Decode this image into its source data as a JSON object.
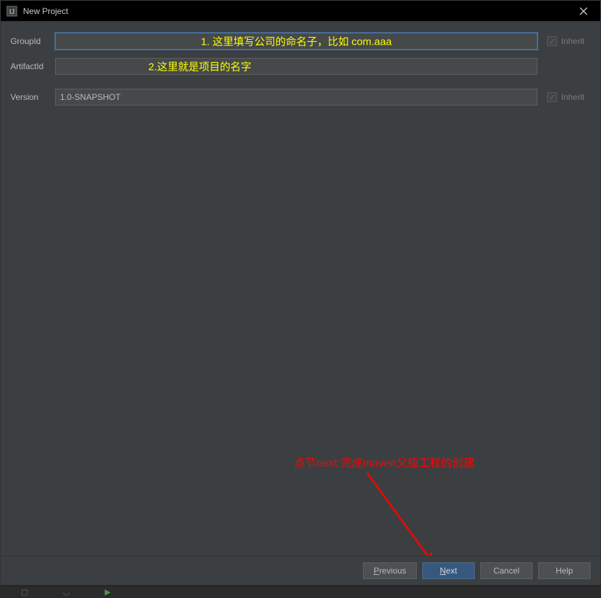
{
  "window": {
    "title": "New Project"
  },
  "form": {
    "groupId": {
      "label": "GroupId",
      "value": "",
      "annotation": "1. 这里填写公司的命名子，比如 com.aaa",
      "inheritLabel": "Inherit",
      "inheritChecked": true
    },
    "artifactId": {
      "label": "ArtifactId",
      "value": "",
      "annotation": "2.这里就是项目的名字"
    },
    "version": {
      "label": "Version",
      "value": "1.0-SNAPSHOT",
      "inheritLabel": "Inherit",
      "inheritChecked": true
    }
  },
  "annotations": {
    "nextHint": "点节next 完成maven父级工程的创建"
  },
  "buttons": {
    "previous": "Previous",
    "previousKey": "P",
    "next": "Next",
    "nextKey": "N",
    "cancel": "Cancel",
    "help": "Help"
  }
}
